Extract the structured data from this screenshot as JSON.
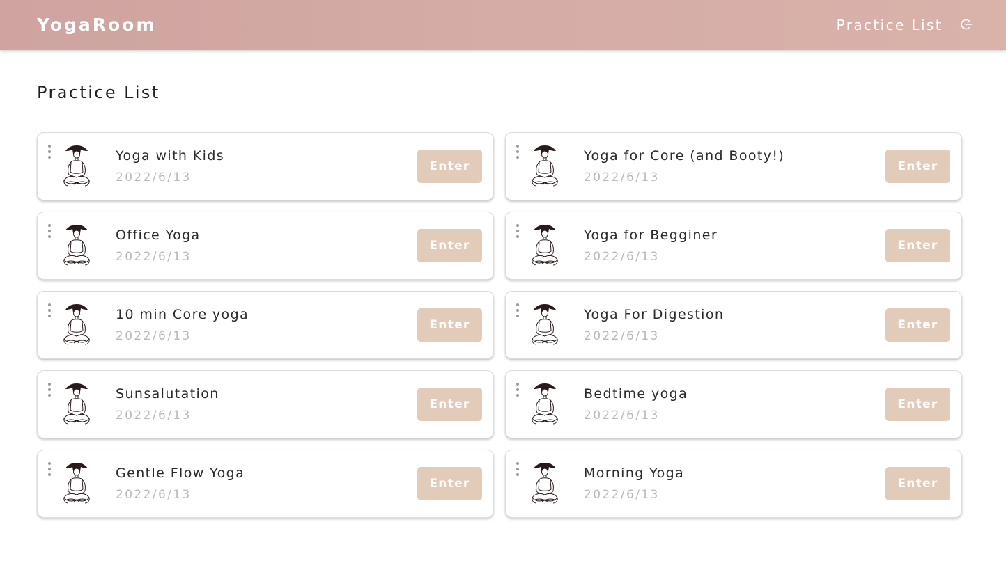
{
  "header": {
    "brand": "YogaRoom",
    "nav_label": "Practice List",
    "logout_icon": "logout-icon"
  },
  "main": {
    "title": "Practice List",
    "enter_label": "Enter",
    "practices": [
      {
        "title": "Yoga with Kids",
        "date": "2022/6/13"
      },
      {
        "title": "Yoga for Core (and Booty!)",
        "date": "2022/6/13"
      },
      {
        "title": "Office Yoga",
        "date": "2022/6/13"
      },
      {
        "title": "Yoga for Begginer",
        "date": "2022/6/13"
      },
      {
        "title": "10 min Core yoga",
        "date": "2022/6/13"
      },
      {
        "title": "Yoga For Digestion",
        "date": "2022/6/13"
      },
      {
        "title": "Sunsalutation",
        "date": "2022/6/13"
      },
      {
        "title": "Bedtime yoga",
        "date": "2022/6/13"
      },
      {
        "title": "Gentle Flow Yoga",
        "date": "2022/6/13"
      },
      {
        "title": "Morning Yoga",
        "date": "2022/6/13"
      }
    ]
  },
  "colors": {
    "header_bg": "#d5aca6",
    "button_bg": "#e2cbb9",
    "date_text": "#b9b9b9"
  },
  "icons": {
    "menu": "more-vertical-icon",
    "avatar": "meditating-person-icon"
  }
}
